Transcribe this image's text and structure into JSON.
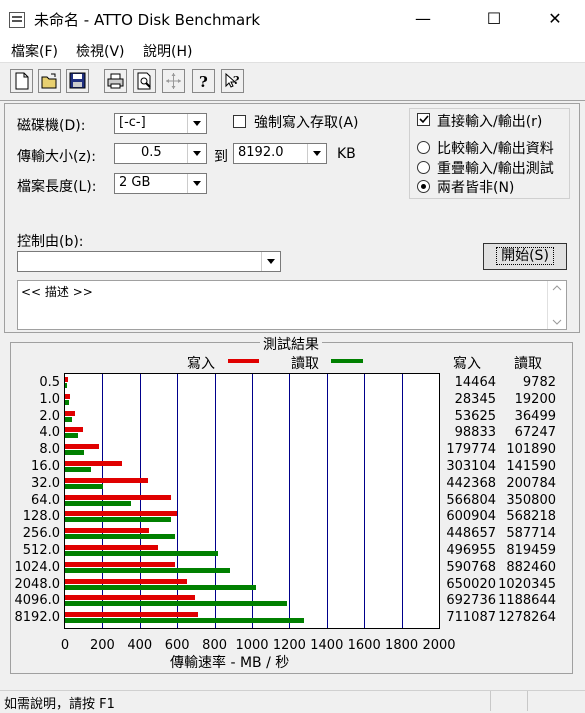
{
  "window": {
    "title": "未命名 - ATTO Disk Benchmark",
    "minimize": "—",
    "maximize": "☐",
    "close": "✕"
  },
  "menu": [
    "檔案(F)",
    "檢視(V)",
    "說明(H)"
  ],
  "toolbar": [
    "new-file-icon",
    "open-folder-icon",
    "save-icon",
    "print-icon",
    "print-preview-icon",
    "move-icon",
    "help-icon",
    "context-help-icon"
  ],
  "settings": {
    "drive_label": "磁碟機(D):",
    "drive_value": "[-c-]",
    "transfer_label": "傳輸大小(z):",
    "transfer_from": "0.5",
    "to_label": "到",
    "transfer_to": "8192.0",
    "unit": "KB",
    "length_label": "檔案長度(L):",
    "length_value": "2 GB",
    "force_write_label": "強制寫入存取(A)",
    "direct_io_label": "直接輸入/輸出(r)",
    "radio_options": [
      "比較輸入/輸出資料",
      "重疊輸入/輸出測試",
      "兩者皆非(N)"
    ],
    "radio_selected": 2,
    "controlled_by_label": "控制由(b):",
    "controlled_by_value": "",
    "start_label": "開始(S)",
    "description": "<< 描述 >>"
  },
  "results": {
    "title": "測試結果",
    "write_label": "寫入",
    "read_label": "讀取",
    "write_col": "寫入",
    "read_col": "讀取",
    "write_color": "#e00000",
    "read_color": "#008000"
  },
  "chart_data": {
    "type": "bar",
    "orientation": "horizontal",
    "categories": [
      "0.5",
      "1.0",
      "2.0",
      "4.0",
      "8.0",
      "16.0",
      "32.0",
      "64.0",
      "128.0",
      "256.0",
      "512.0",
      "1024.0",
      "2048.0",
      "4096.0",
      "8192.0"
    ],
    "series": [
      {
        "name": "寫入",
        "values": [
          14464,
          28345,
          53625,
          98833,
          179774,
          303104,
          442368,
          566804,
          600904,
          448657,
          496955,
          590768,
          650020,
          692736,
          711087
        ]
      },
      {
        "name": "讀取",
        "values": [
          9782,
          19200,
          36499,
          67247,
          101890,
          141590,
          200784,
          350800,
          568218,
          587714,
          819459,
          882460,
          1020345,
          1188644,
          1278264
        ]
      }
    ],
    "xticks": [
      "0",
      "200",
      "400",
      "600",
      "800",
      "1000",
      "1200",
      "1400",
      "1600",
      "1800",
      "2000"
    ],
    "xlim": [
      0,
      2000
    ],
    "xlabel": "傳輸速率 - MB / 秒",
    "grid": true
  },
  "status": {
    "text": "如需說明，請按 F1"
  }
}
